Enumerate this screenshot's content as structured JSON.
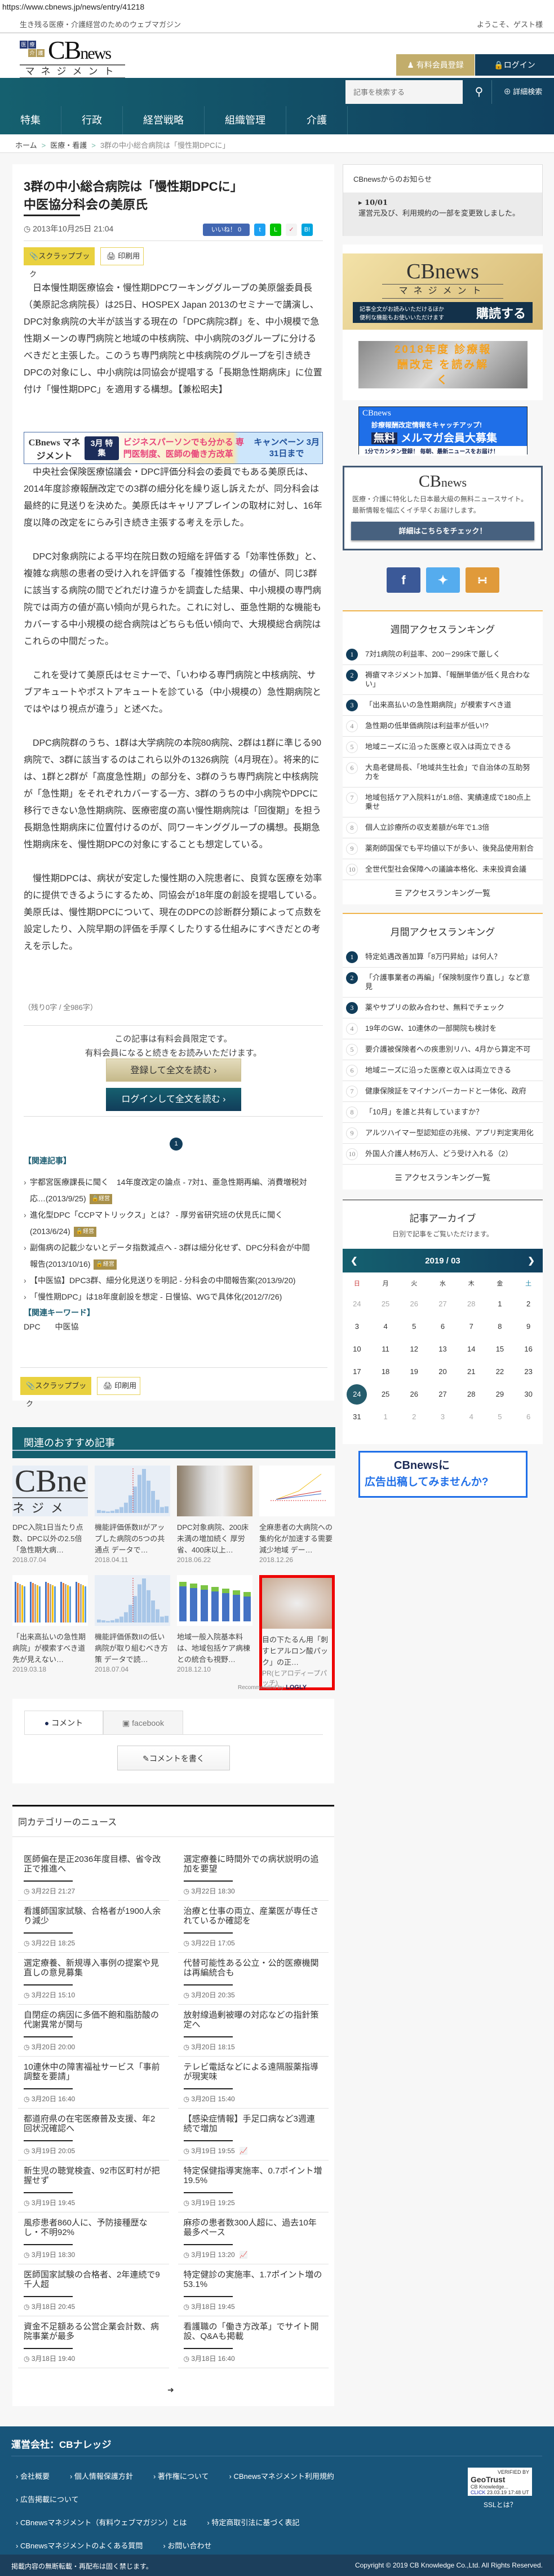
{
  "url": "https://www.cbnews.jp/news/entry/41218",
  "header": {
    "tagline": "生き残る医療・介護経営のためのウェブマガジン",
    "welcome": "ようこそ、ゲスト様",
    "logo_tags": [
      "医",
      "療",
      "介",
      "護"
    ],
    "logo_main": "CB",
    "logo_news": "news",
    "logo_sub": "マネジメント",
    "register": "有料会員登録",
    "login": "ログイン",
    "search_placeholder": "記事を検索する",
    "advanced_search": "詳細検索",
    "nav": [
      "特集",
      "行政",
      "経営戦略",
      "組織管理",
      "介護"
    ]
  },
  "breadcrumb": [
    "ホーム",
    "医療・看護",
    "3群の中小総合病院は「慢性期DPCに」"
  ],
  "article": {
    "title_line1": "3群の中小総合病院は「慢性期DPCに」",
    "title_line2": "中医協分科会の美原氏",
    "date": "2013年10月25日 21:04",
    "like_label": "いいね！ 0",
    "scrapbook": "スクラップブック",
    "print": "印刷用",
    "paragraphs_before_ad": [
      "日本慢性期医療協会・慢性期DPCワーキンググループの美原盤委員長（美原記念病院長）は25日、HOSPEX Japan 2013のセミナーで講演し、DPC対象病院の大半が該当する現在の「DPC病院3群」を、中小規模で急性期メーンの専門病院と地域の中核病院、中小病院の3グループに分けるべきだと主張した。このうち専門病院と中核病院のグループを引き続きDPCの対象にし、中小病院は同協会が提唱する「長期急性期病床」に位置付け「慢性期DPC」を適用する構想。【兼松昭夫】"
    ],
    "ad_banner": {
      "logo": "CBnews マネジメント",
      "badge": "3月 特集",
      "text": "ビジネスパーソンでも分かる 専門医制度、医師の働き方改革",
      "campaign": "キャンペーン 3月31日まで"
    },
    "paragraphs": [
      "中央社会保険医療協議会・DPC評価分科会の委員でもある美原氏は、2014年度診療報酬改定での3群の細分化を繰り返し訴えたが、同分科会は最終的に見送りを決めた。美原氏はキャリアブレインの取材に対し、16年度以降の改定をにらみ引き続き主張する考えを示した。",
      "DPC対象病院による平均在院日数の短縮を評価する「効率性係数」と、複雑な病態の患者の受け入れを評価する「複雑性係数」の値が、同じ3群に該当する病院の間でどれだけ違うかを調査した結果、中小規模の専門病院では両方の値が高い傾向が見られた。これに対し、亜急性期的な機能もカバーする中小規模の総合病院はどちらも低い傾向で、大規模総合病院はこれらの中間だった。",
      "これを受けて美原氏はセミナーで、「いわゆる専門病院と中核病院、サブアキュートやポストアキュートを診ている（中小規模の）急性期病院とではやはり視点が違う」と述べた。",
      "DPC病院群のうち、1群は大学病院の本院80病院、2群は1群に準じる90病院で、3群に該当するのはこれら以外の1326病院（4月現在）。将来的には、1群と2群が「高度急性期」の部分を、3群のうち専門病院と中核病院が「急性期」をそれぞれカバーする一方、3群のうちの中小病院やDPCに移行できない急性期病院、医療密度の高い慢性期病院は「回復期」を担う長期急性期病床に位置付けるのが、同ワーキンググループの構想。長期急性期病床を、慢性期DPCの対象にすることも想定している。",
      "慢性期DPCは、病状が安定した慢性期の入院患者に、良質な医療を効率的に提供できるようにするため、同協会が18年度の創設を提唱している。美原氏は、慢性期DPCについて、現在のDPCの診断群分類によって点数を設定したり、入院早期の評価を手厚くしたりする仕組みにすべきだとの考えを示した。"
    ],
    "remaining": "（残り0字 / 全986字）",
    "paywall_line1": "この記事は有料会員限定です。",
    "paywall_line2": "有料会員になると続きをお読みいただけます。",
    "register_read": "登録して全文を読む ›",
    "login_read": "ログインして全文を読む ›",
    "page": "1",
    "related_heading": "【関連記事】",
    "related": [
      {
        "text": "宇都宮医療課長に聞く　14年度改定の論点 - 7対1、亜急性期再編、消費増税対応…(2013/9/25)",
        "badge": "経営"
      },
      {
        "text": "進化型DPC「CCPマトリックス」とは？ - 厚労省研究班の伏見氏に聞く(2013/6/24)",
        "badge": "経営"
      },
      {
        "text": "副傷病の記載少ないとデータ指数減点へ - 3群は細分化せず、DPC分科会が中間報告(2013/10/16)",
        "badge": "経営"
      },
      {
        "text": "【中医協】DPC3群、細分化見送りを明記 - 分科会の中間報告案(2013/9/20)",
        "badge": null
      },
      {
        "text": "「慢性期DPC」は18年度創設を想定 - 日慢協、WGで具体化(2012/7/26)",
        "badge": null
      }
    ],
    "keywords_heading": "【関連キーワード】",
    "keywords": [
      "DPC",
      "中医協"
    ]
  },
  "recommended": {
    "heading": "関連のおすすめ記事",
    "items": [
      {
        "title": "DPC入院1日当たり点数、DPC以外の2.5倍 「急性期大病…",
        "date": "2018.07.04",
        "img": "logo"
      },
      {
        "title": "機能評価係数IIがアップした病院の5つの共通点 データで…",
        "date": "2018.04.11",
        "img": "histogram"
      },
      {
        "title": "DPC対象病院、200床未満の増加続く 厚労省、400床以上…",
        "date": "2018.06.22",
        "img": "corridor"
      },
      {
        "title": "全麻患者の大病院への集約化が加速する需要減少地域 デー…",
        "date": "2018.12.26",
        "img": "line"
      },
      {
        "title": "「出来高払いの急性期病院」が模索すべき道 先が見えない…",
        "date": "2019.03.18",
        "img": "bars"
      },
      {
        "title": "機能評価係数IIの低い病院が取り組むべき方策 データで読…",
        "date": "2018.07.04",
        "img": "histogram"
      },
      {
        "title": "地域一般入院基本料は、地域包括ケア病棟との統合も視野…",
        "date": "2018.12.10",
        "img": "stacked"
      },
      {
        "title": "目の下たるん用「刺すヒアルロン酸パック」の正…",
        "date": "PR(ヒアロディープパッチ)",
        "img": "pr"
      }
    ],
    "recommended_by": "Recommended by",
    "brand": "LOGLY"
  },
  "comments": {
    "tab_comment": "コメント",
    "tab_facebook": "facebook",
    "write": "コメントを書く"
  },
  "same_category": {
    "heading": "同カテゴリーのニュース",
    "left": [
      {
        "title": "医師偏在是正2036年度目標、省令改正で推進へ",
        "time": "3月22日 21:27"
      },
      {
        "title": "看護師国家試験、合格者が1900人余り減少",
        "time": "3月22日 18:25"
      },
      {
        "title": "選定療養、新規導入事例の提案や見直しの意見募集",
        "time": "3月22日 15:10"
      },
      {
        "title": "自閉症の病因に多価不飽和脂肪酸の代謝異常が関与",
        "time": "3月20日 20:00"
      },
      {
        "title": "10連休中の障害福祉サービス「事前調整を要請」",
        "time": "3月20日 16:40"
      },
      {
        "title": "都道府県の在宅医療普及支援、年2回状況確認へ",
        "time": "3月19日 20:05"
      },
      {
        "title": "新生児の聴覚検査、92市区町村が把握せず",
        "time": "3月19日 19:45"
      },
      {
        "title": "風疹患者860人に、予防接種歴なし・不明92%",
        "time": "3月19日 18:30"
      },
      {
        "title": "医師国家試験の合格者、2年連続で9千人超",
        "time": "3月18日 20:45"
      },
      {
        "title": "資金不足額ある公営企業会計数、病院事業が最多",
        "time": "3月18日 19:40"
      }
    ],
    "right": [
      {
        "title": "選定療養に時間外での病状説明の追加を要望",
        "time": "3月22日 18:30"
      },
      {
        "title": "治療と仕事の両立、産業医が専任されているか確認を",
        "time": "3月22日 17:05"
      },
      {
        "title": "代替可能性ある公立・公的医療機関は再編統合も",
        "time": "3月20日 20:35"
      },
      {
        "title": "放射線過剰被曝の対応などの指針策定へ",
        "time": "3月20日 18:15"
      },
      {
        "title": "テレビ電話などによる遠隔服薬指導が現実味",
        "time": "3月20日 15:40"
      },
      {
        "title": "【感染症情報】手足口病など3週連続で増加",
        "time": "3月19日 19:55",
        "chart": true
      },
      {
        "title": "特定保健指導実施率、0.7ポイント増19.5%",
        "time": "3月19日 19:25"
      },
      {
        "title": "麻疹の患者数300人超に、過去10年最多ペース",
        "time": "3月19日 13:20",
        "chart": true
      },
      {
        "title": "特定健診の実施率、1.7ポイント増の53.1%",
        "time": "3月18日 19:45"
      },
      {
        "title": "看護職の「働き方改革」でサイト開設、Q&Aも掲載",
        "time": "3月18日 16:40"
      }
    ]
  },
  "sidebar": {
    "notice_heading": "CBnewsからのお知らせ",
    "notice_date": "10/01",
    "notice_text": "運営元及び、利用規約の一部を変更致しました。",
    "subscribe_ad": {
      "line1": "記事全文がお読みいただけるほか",
      "line2": "便利な機能もお使いいただけます",
      "cta": "購読する"
    },
    "revision_ad": "2018年度 診療報酬改定 を読み解く",
    "mail_ad": {
      "brand": "CBnews",
      "line1": "診療報酬改定情報をキャッチアップ!",
      "free": "無料",
      "line2": "メルマガ会員大募集",
      "line3": "1分でカンタン登録！ 毎朝、最新ニュースをお届け！"
    },
    "cbnews_box": {
      "desc": "医療・介護に特化した日本最大級の無料ニュースサイト。最新情報を幅広くイチ早くお届けします。",
      "button": "詳細はこちらをチェック！"
    },
    "weekly": {
      "heading": "週間アクセスランキング",
      "items": [
        "7対1病院の利益率、200－299床で厳しく",
        "褥瘡マネジメント加算、「報酬単価が低く見合わない」",
        "「出来高払いの急性期病院」が模索すべき道",
        "急性期の低単価病院は利益率が低い!?",
        "地域ニーズに沿った医療と収入は両立できる",
        "大島老健局長、「地域共生社会」で自治体の互助努力を",
        "地域包括ケア入院料1が1.8倍、実績達成で180点上乗せ",
        "個人立診療所の収支差額が6年で1.3倍",
        "薬剤師国保でも平均値以下が多い、後発品使用割合",
        "全世代型社会保障への議論本格化、未来投資会議"
      ],
      "all": "アクセスランキング一覧"
    },
    "monthly": {
      "heading": "月間アクセスランキング",
      "items": [
        "特定処遇改善加算「8万円昇給」は何人？",
        "「介護事業者の再編」「保険制度作り直し」など意見",
        "薬やサプリの飲み合わせ、無料でチェック",
        "19年のGW、10連休の一部開院も検討を",
        "要介護被保険者への疾患別リハ、4月から算定不可",
        "地域ニーズに沿った医療と収入は両立できる",
        "健康保険証をマイナンバーカードと一体化、政府",
        "「10月」を誰と共有していますか？",
        "アルツハイマー型認知症の兆候、アプリ判定実用化",
        "外国人介護人材6万人、どう受け入れる（2）"
      ],
      "all": "アクセスランキング一覧"
    },
    "archive": {
      "heading": "記事アーカイブ",
      "sub": "日別で記事をご覧いただけます。",
      "month": "2019 / 03",
      "weekdays": [
        "日",
        "月",
        "火",
        "水",
        "木",
        "金",
        "土"
      ],
      "days": [
        "24",
        "25",
        "26",
        "27",
        "28",
        "1",
        "2",
        "3",
        "4",
        "5",
        "6",
        "7",
        "8",
        "9",
        "10",
        "11",
        "12",
        "13",
        "14",
        "15",
        "16",
        "17",
        "18",
        "19",
        "20",
        "21",
        "22",
        "23",
        "24",
        "25",
        "26",
        "27",
        "28",
        "29",
        "30",
        "31",
        "1",
        "2",
        "3",
        "4",
        "5",
        "6"
      ],
      "selected": "24"
    },
    "ad_bottom": {
      "line1": "CBnewsに",
      "line2": "広告出稿してみませんか?"
    }
  },
  "footer": {
    "company": "運営会社：CBナレッジ",
    "links": [
      "会社概要",
      "個人情報保護方針",
      "著作権について",
      "CBnewsマネジメント利用規約",
      "広告掲載について",
      "CBnewsマネジメント（有料ウェブマガジン）とは",
      "特定商取引法に基づく表記",
      "CBnewsマネジメントのよくある質問",
      "お問い合わせ"
    ],
    "geotrust": {
      "verified": "VERIFIED BY",
      "brand": "GeoTrust",
      "org": "CB Knowledge...",
      "click": "CLICK",
      "stamp": "23.03.19 17:48 UT"
    },
    "ssl": "SSLとは？",
    "notice": "掲載内容の無断転載・再配布は固く禁じます。",
    "copyright": "Copyright © 2019 CB Knowledge Co.,Ltd. All Rights Reserved."
  },
  "colors": {
    "brand": "#113d5a",
    "teal": "#15606f",
    "gold": "#c2ad6b",
    "scrap": "#e9d13f"
  }
}
